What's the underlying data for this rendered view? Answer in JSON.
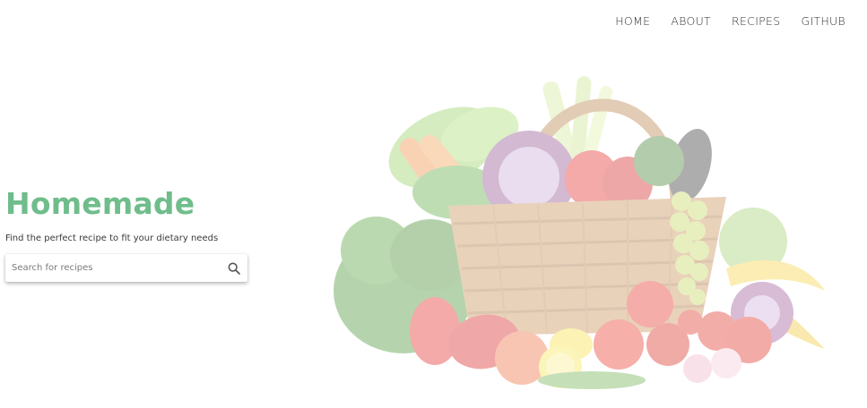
{
  "nav": {
    "items": [
      {
        "label": "HOME"
      },
      {
        "label": "ABOUT"
      },
      {
        "label": "RECIPES"
      },
      {
        "label": "GITHUB"
      }
    ]
  },
  "hero": {
    "title": "Homemade",
    "tagline": "Find the perfect recipe to fit your dietary needs",
    "search": {
      "placeholder": "Search for recipes",
      "value": "",
      "icon": "search-icon"
    },
    "image": "vegetable-basket-illustration"
  },
  "colors": {
    "brand": "#6fbd8b",
    "nav_text": "#2f2f2f"
  }
}
